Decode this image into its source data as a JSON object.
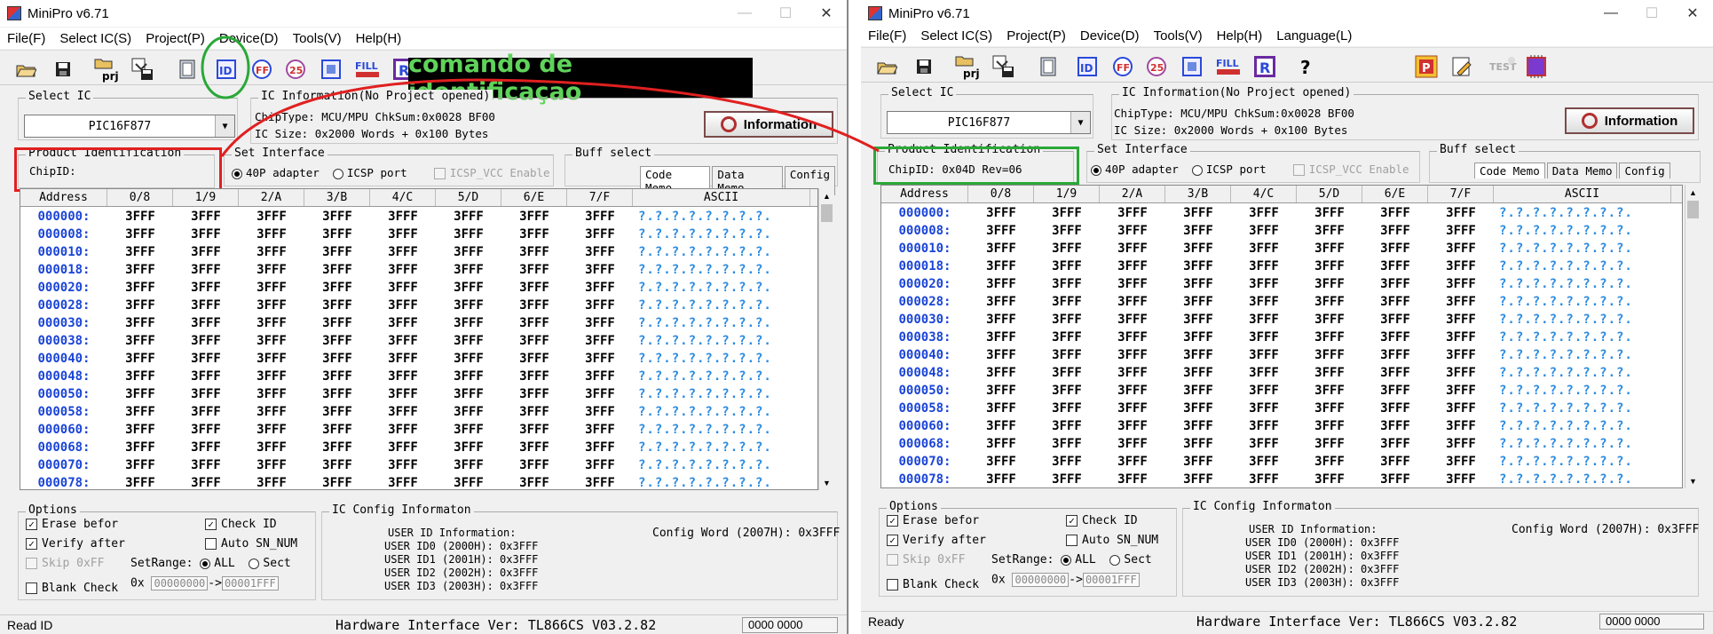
{
  "annotation": {
    "banner_text": "comando de identificaçao"
  },
  "columns": [
    "Address",
    "0/8",
    "1/9",
    "2/A",
    "3/B",
    "4/C",
    "5/D",
    "6/E",
    "7/F",
    "ASCII"
  ],
  "rows": [
    {
      "addr": "000000:",
      "vals": [
        "3FFF",
        "3FFF",
        "3FFF",
        "3FFF",
        "3FFF",
        "3FFF",
        "3FFF",
        "3FFF"
      ],
      "ascii": "?.?.?.?.?.?.?.?."
    },
    {
      "addr": "000008:",
      "vals": [
        "3FFF",
        "3FFF",
        "3FFF",
        "3FFF",
        "3FFF",
        "3FFF",
        "3FFF",
        "3FFF"
      ],
      "ascii": "?.?.?.?.?.?.?.?."
    },
    {
      "addr": "000010:",
      "vals": [
        "3FFF",
        "3FFF",
        "3FFF",
        "3FFF",
        "3FFF",
        "3FFF",
        "3FFF",
        "3FFF"
      ],
      "ascii": "?.?.?.?.?.?.?.?."
    },
    {
      "addr": "000018:",
      "vals": [
        "3FFF",
        "3FFF",
        "3FFF",
        "3FFF",
        "3FFF",
        "3FFF",
        "3FFF",
        "3FFF"
      ],
      "ascii": "?.?.?.?.?.?.?.?."
    },
    {
      "addr": "000020:",
      "vals": [
        "3FFF",
        "3FFF",
        "3FFF",
        "3FFF",
        "3FFF",
        "3FFF",
        "3FFF",
        "3FFF"
      ],
      "ascii": "?.?.?.?.?.?.?.?."
    },
    {
      "addr": "000028:",
      "vals": [
        "3FFF",
        "3FFF",
        "3FFF",
        "3FFF",
        "3FFF",
        "3FFF",
        "3FFF",
        "3FFF"
      ],
      "ascii": "?.?.?.?.?.?.?.?."
    },
    {
      "addr": "000030:",
      "vals": [
        "3FFF",
        "3FFF",
        "3FFF",
        "3FFF",
        "3FFF",
        "3FFF",
        "3FFF",
        "3FFF"
      ],
      "ascii": "?.?.?.?.?.?.?.?."
    },
    {
      "addr": "000038:",
      "vals": [
        "3FFF",
        "3FFF",
        "3FFF",
        "3FFF",
        "3FFF",
        "3FFF",
        "3FFF",
        "3FFF"
      ],
      "ascii": "?.?.?.?.?.?.?.?."
    },
    {
      "addr": "000040:",
      "vals": [
        "3FFF",
        "3FFF",
        "3FFF",
        "3FFF",
        "3FFF",
        "3FFF",
        "3FFF",
        "3FFF"
      ],
      "ascii": "?.?.?.?.?.?.?.?."
    },
    {
      "addr": "000048:",
      "vals": [
        "3FFF",
        "3FFF",
        "3FFF",
        "3FFF",
        "3FFF",
        "3FFF",
        "3FFF",
        "3FFF"
      ],
      "ascii": "?.?.?.?.?.?.?.?."
    },
    {
      "addr": "000050:",
      "vals": [
        "3FFF",
        "3FFF",
        "3FFF",
        "3FFF",
        "3FFF",
        "3FFF",
        "3FFF",
        "3FFF"
      ],
      "ascii": "?.?.?.?.?.?.?.?."
    },
    {
      "addr": "000058:",
      "vals": [
        "3FFF",
        "3FFF",
        "3FFF",
        "3FFF",
        "3FFF",
        "3FFF",
        "3FFF",
        "3FFF"
      ],
      "ascii": "?.?.?.?.?.?.?.?."
    },
    {
      "addr": "000060:",
      "vals": [
        "3FFF",
        "3FFF",
        "3FFF",
        "3FFF",
        "3FFF",
        "3FFF",
        "3FFF",
        "3FFF"
      ],
      "ascii": "?.?.?.?.?.?.?.?."
    },
    {
      "addr": "000068:",
      "vals": [
        "3FFF",
        "3FFF",
        "3FFF",
        "3FFF",
        "3FFF",
        "3FFF",
        "3FFF",
        "3FFF"
      ],
      "ascii": "?.?.?.?.?.?.?.?."
    },
    {
      "addr": "000070:",
      "vals": [
        "3FFF",
        "3FFF",
        "3FFF",
        "3FFF",
        "3FFF",
        "3FFF",
        "3FFF",
        "3FFF"
      ],
      "ascii": "?.?.?.?.?.?.?.?."
    },
    {
      "addr": "000078:",
      "vals": [
        "3FFF",
        "3FFF",
        "3FFF",
        "3FFF",
        "3FFF",
        "3FFF",
        "3FFF",
        "3FFF"
      ],
      "ascii": "?.?.?.?.?.?.?.?."
    }
  ],
  "toolbar_icons": [
    "open-icon",
    "save-icon",
    "project-icon",
    "save-project-icon",
    "chip-select-icon",
    "read-id-icon",
    "erase-fill-icon",
    "blank-check-icon",
    "program-icon",
    "fill-icon",
    "read-icon",
    "help-icon",
    "chip-red-icon",
    "edit-icon",
    "test-icon",
    "chip-purple-icon"
  ],
  "left": {
    "title": "MiniPro v6.71",
    "menu": [
      "File(F)",
      "Select IC(S)",
      "Project(P)",
      "Device(D)",
      "Tools(V)",
      "Help(H)"
    ],
    "select_ic_label": "Select IC",
    "ic_name": "PIC16F877",
    "ic_info_label": "IC Information(No Project opened)",
    "chip_type": "ChipType:  MCU/MPU   ChkSum:0x0028 BF00",
    "ic_size": "IC Size:   0x2000 Words + 0x100 Bytes",
    "information_button": "Information",
    "product_id_label": "Product Identification",
    "chip_id": "ChipID:",
    "set_interface_label": "Set Interface",
    "adapter_40p": "40P adapter",
    "icsp_port": "ICSP port",
    "icsp_vcc": "ICSP_VCC Enable",
    "buff_select_label": "Buff select",
    "buff_tabs": [
      "Code Memo",
      "Data Memo",
      "Config"
    ],
    "options_label": "Options",
    "erase_before": "Erase befor",
    "verify_after": "Verify after",
    "skip_0xff": "Skip 0xFF",
    "blank_check": "Blank Check",
    "check_id": "Check ID",
    "auto_sn": "Auto SN_NUM",
    "setrange": "SetRange:",
    "all": "ALL",
    "sect": "Sect",
    "range_prefix": "0x",
    "range_start": "00000000",
    "range_arrow": "->",
    "range_end": "00001FFF",
    "ic_config_label": "IC Config Informaton",
    "config_word": "Config Word (2007H): 0x3FFF",
    "user_id_info": "USER ID Information:",
    "user_ids": [
      "USER ID0 (2000H): 0x3FFF",
      "USER ID1 (2001H): 0x3FFF",
      "USER ID2 (2002H): 0x3FFF",
      "USER ID3 (2003H): 0x3FFF"
    ],
    "status_text": "Read ID",
    "hw_ver": "Hardware Interface Ver: TL866CS V03.2.82",
    "status_box": "0000 0000"
  },
  "right": {
    "title": "MiniPro v6.71",
    "menu": [
      "File(F)",
      "Select IC(S)",
      "Project(P)",
      "Device(D)",
      "Tools(V)",
      "Help(H)",
      "Language(L)"
    ],
    "select_ic_label": "Select IC",
    "ic_name": "PIC16F877",
    "ic_info_label": "IC Information(No Project opened)",
    "chip_type": "ChipType:  MCU/MPU   ChkSum:0x0028 BF00",
    "ic_size": "IC Size:   0x2000 Words + 0x100 Bytes",
    "information_button": "Information",
    "product_id_label": "Product Identification",
    "chip_id": "ChipID: 0x04D Rev=06",
    "set_interface_label": "Set Interface",
    "adapter_40p": "40P adapter",
    "icsp_port": "ICSP port",
    "icsp_vcc": "ICSP_VCC Enable",
    "buff_select_label": "Buff select",
    "buff_tabs": [
      "Code Memo",
      "Data Memo",
      "Config"
    ],
    "options_label": "Options",
    "erase_before": "Erase befor",
    "verify_after": "Verify after",
    "skip_0xff": "Skip 0xFF",
    "blank_check": "Blank Check",
    "check_id": "Check ID",
    "auto_sn": "Auto SN_NUM",
    "setrange": "SetRange:",
    "all": "ALL",
    "sect": "Sect",
    "range_prefix": "0x",
    "range_start": "00000000",
    "range_arrow": "->",
    "range_end": "00001FFF",
    "ic_config_label": "IC Config Informaton",
    "config_word": "Config Word (2007H): 0x3FFF",
    "user_id_info": "USER ID Information:",
    "user_ids": [
      "USER ID0 (2000H): 0x3FFF",
      "USER ID1 (2001H): 0x3FFF",
      "USER ID2 (2002H): 0x3FFF",
      "USER ID3 (2003H): 0x3FFF"
    ],
    "status_text": "Ready",
    "hw_ver": "Hardware Interface Ver: TL866CS V03.2.82",
    "status_box": "0000 0000"
  },
  "colors": {
    "highlight_red": "#e02020",
    "highlight_green": "#2aa838",
    "address_blue": "#1a44d8",
    "ascii_blue": "#2a8ae0",
    "banner_bg": "#000000",
    "banner_fg": "#5fd35a"
  }
}
